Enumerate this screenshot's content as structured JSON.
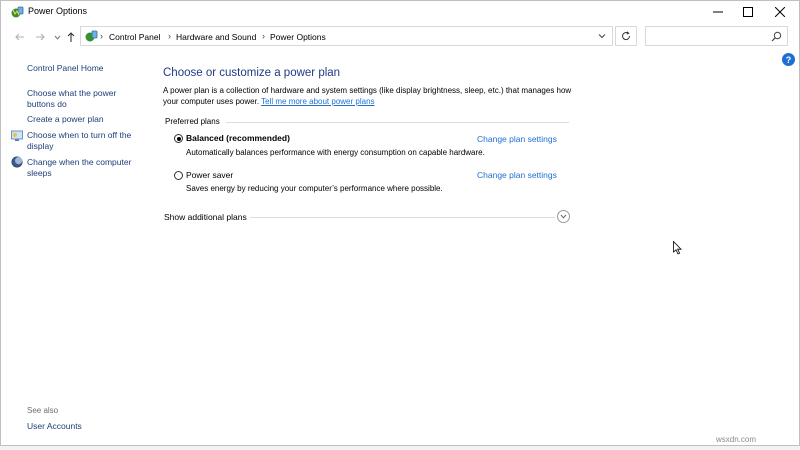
{
  "window": {
    "title": "Power Options"
  },
  "address": {
    "crumbs": [
      "Control Panel",
      "Hardware and Sound",
      "Power Options"
    ],
    "search_placeholder": ""
  },
  "sidebar": {
    "home": "Control Panel Home",
    "items": [
      {
        "label": "Choose what the power buttons do",
        "icon": null
      },
      {
        "label": "Create a power plan",
        "icon": null
      },
      {
        "label": "Choose when to turn off the display",
        "icon": "display-icon"
      },
      {
        "label": "Change when the computer sleeps",
        "icon": "moon-icon"
      }
    ],
    "see_also": "See also",
    "user_accounts": "User Accounts"
  },
  "main": {
    "heading": "Choose or customize a power plan",
    "description": "A power plan is a collection of hardware and system settings (like display brightness, sleep, etc.) that manages how your computer uses power.",
    "learn_more": "Tell me more about power plans",
    "group_label": "Preferred plans",
    "plans": [
      {
        "name": "Balanced (recommended)",
        "description": "Automatically balances performance with energy consumption on capable hardware.",
        "selected": true,
        "link": "Change plan settings"
      },
      {
        "name": "Power saver",
        "description": "Saves energy by reducing your computer’s performance where possible.",
        "selected": false,
        "link": "Change plan settings"
      }
    ],
    "show_more": "Show additional plans"
  },
  "help_label": "?",
  "watermark": "wsxdn.com",
  "colors": {
    "heading": "#1f3b84",
    "link": "#1f6fd1",
    "sidebar_link": "#1e3e78",
    "help": "#1e6fd1"
  }
}
